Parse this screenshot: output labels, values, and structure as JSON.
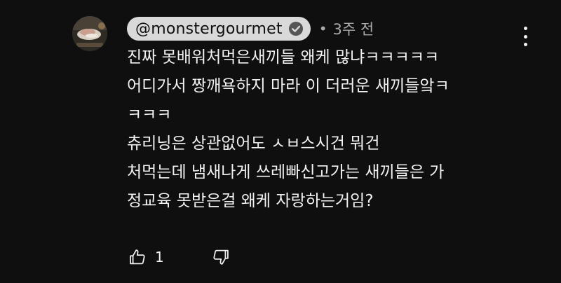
{
  "comment": {
    "author": "@monstergourmet",
    "verified": true,
    "timestamp": "3주 전",
    "separator": "•",
    "avatar_icon": "channel-avatar",
    "text_lines": [
      "진짜 못배워처먹은새끼들 왜케 많냐ㅋㅋㅋㅋㅋ",
      "어디가서 짱깨욕하지 마라 이 더러운 새끼들앜ㅋ",
      "ㅋㅋㅋ",
      "츄리닝은 상관없어도 ㅅㅂ스시건 뭐건",
      "처먹는데 냄새나게 쓰레빠신고가는 새끼들은 가",
      "정교육 못받은걸 왜케 자랑하는거임?"
    ],
    "like_count": "1",
    "icons": {
      "like": "thumbs-up-icon",
      "dislike": "thumbs-down-icon",
      "more": "more-vert-icon",
      "verified": "verified-check-icon"
    }
  }
}
